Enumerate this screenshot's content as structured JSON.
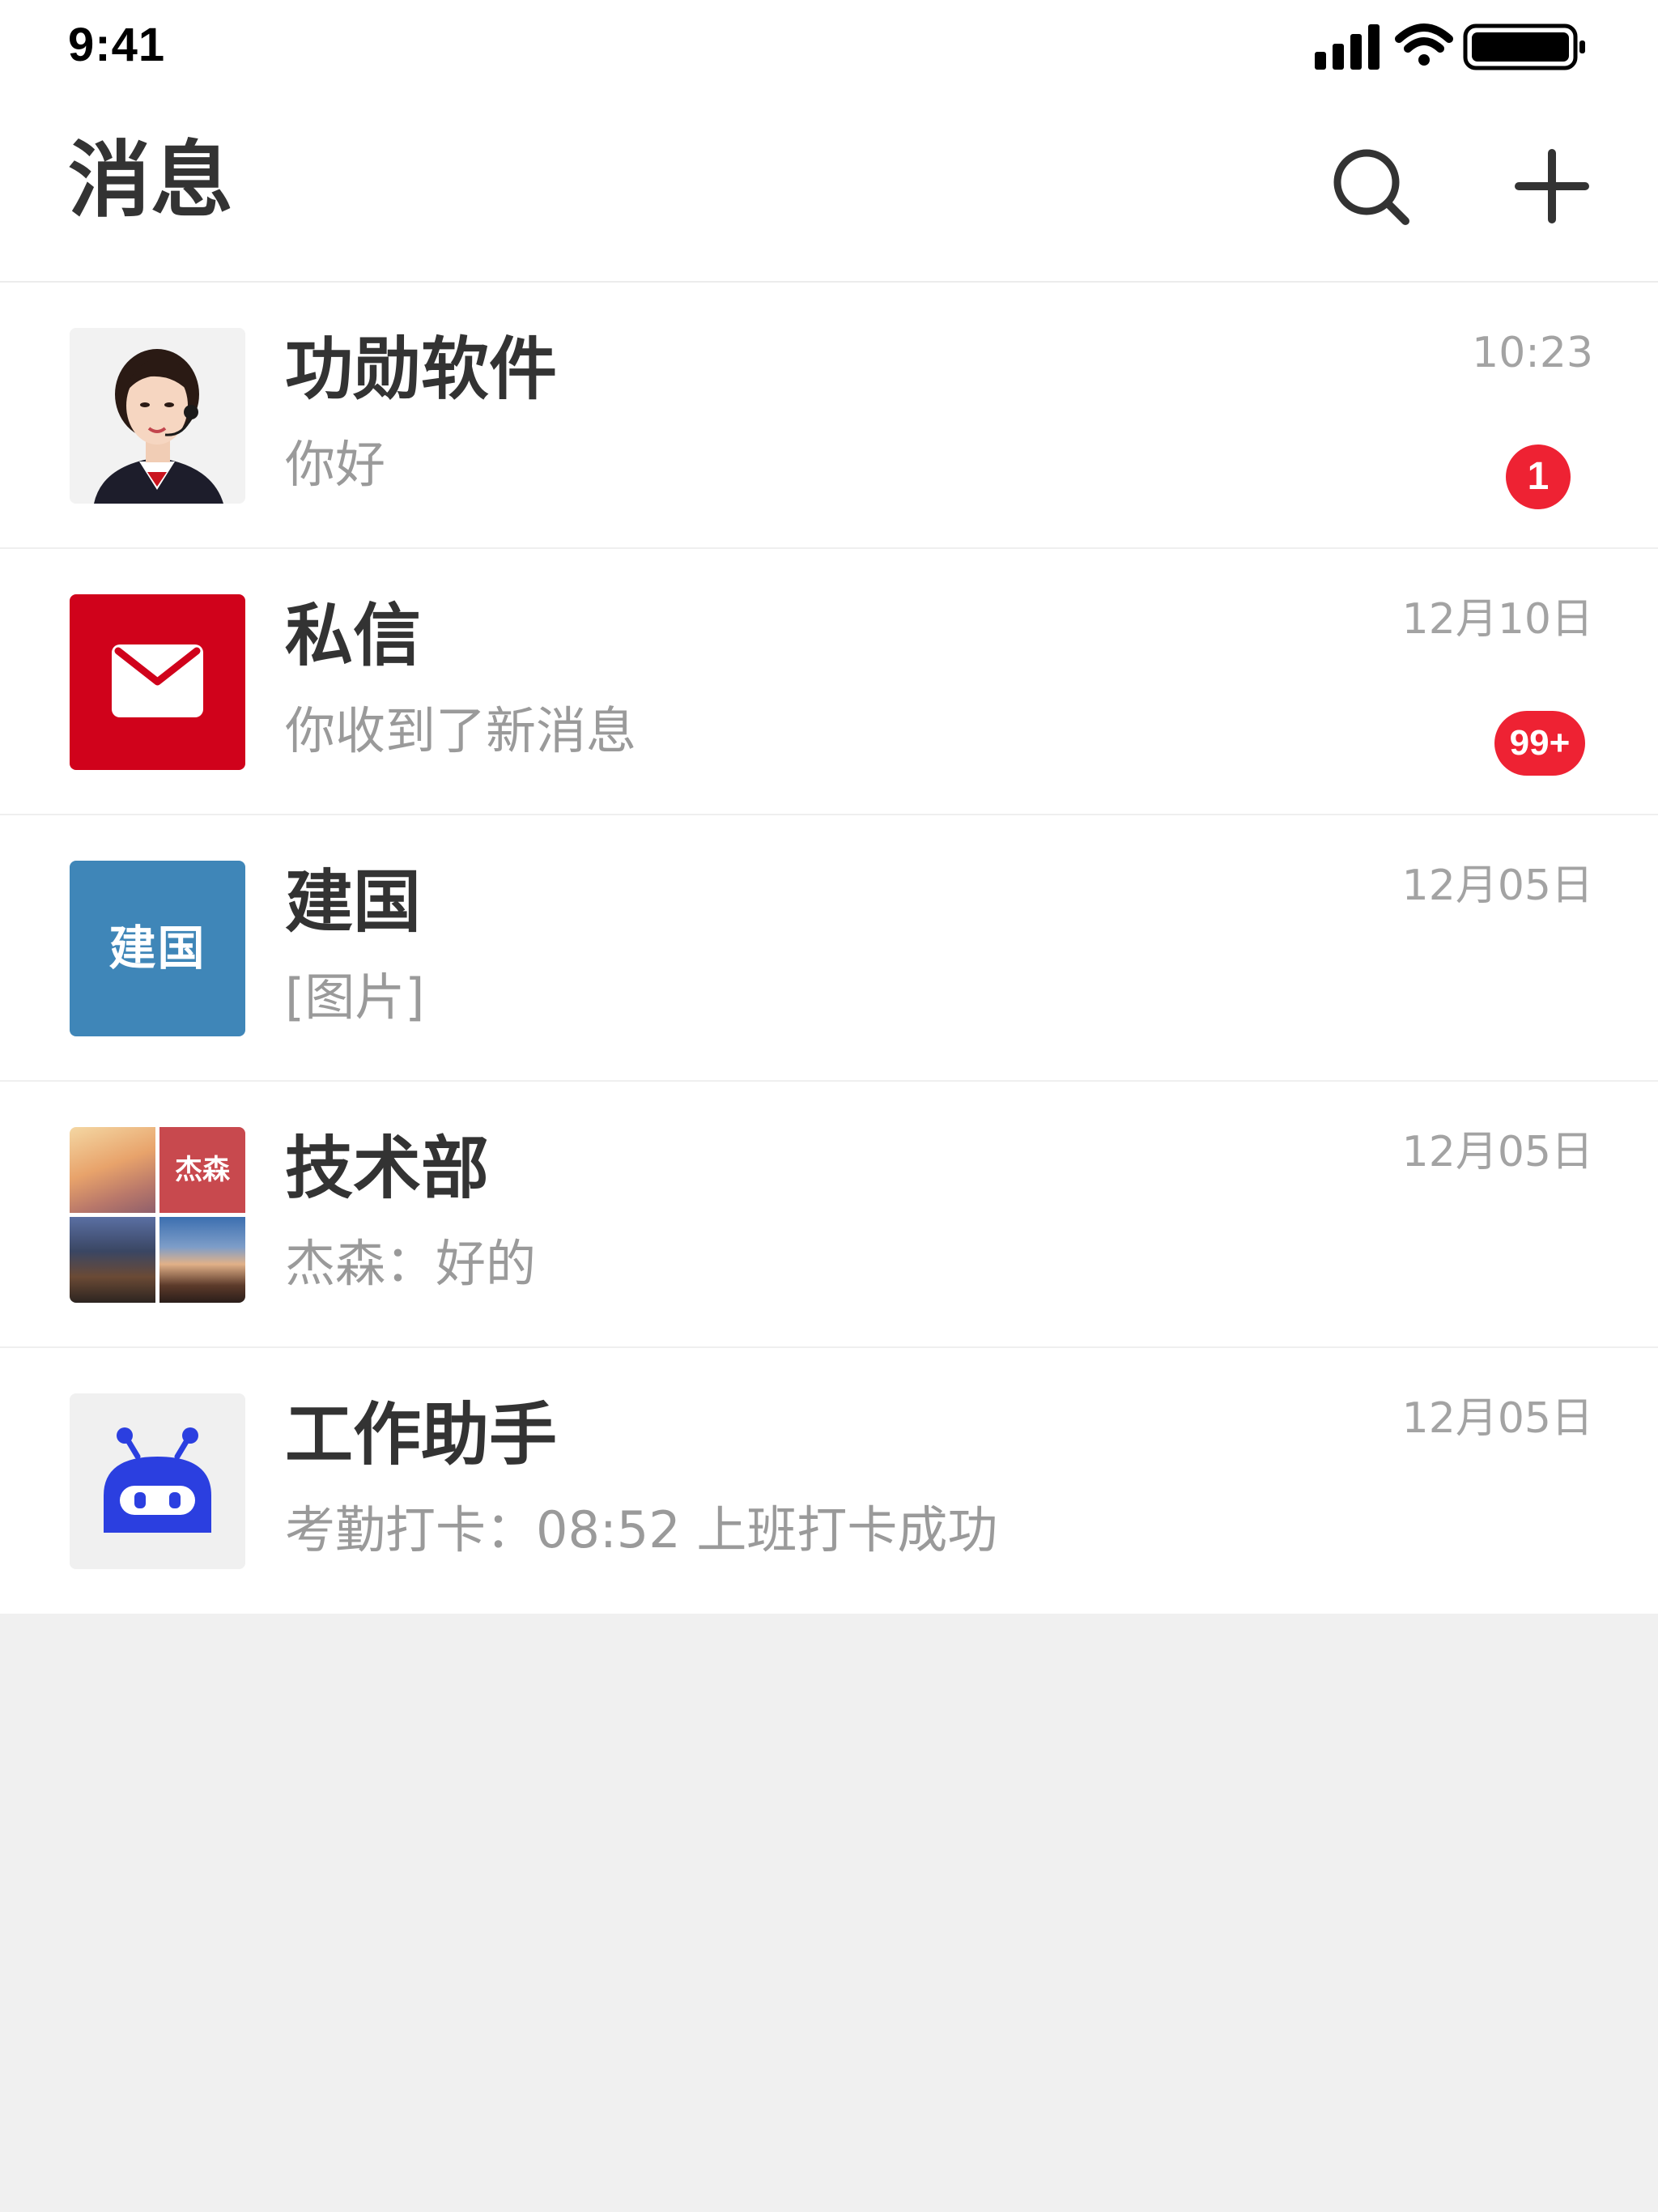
{
  "status_bar": {
    "time": "9:41"
  },
  "header": {
    "title": "消息",
    "search_icon": "search-icon",
    "add_icon": "plus-icon"
  },
  "colors": {
    "badge": "#ee2233",
    "mail_avatar": "#d0021b",
    "text_avatar": "#3f86b8",
    "bot": "#2b3fe0"
  },
  "conversations": [
    {
      "name": "功勋软件",
      "preview": "你好",
      "time": "10:23",
      "badge": "1",
      "avatar": "customer-service-photo"
    },
    {
      "name": "私信",
      "preview": "你收到了新消息",
      "time": "12月10日",
      "badge": "99+",
      "avatar": "mail-icon"
    },
    {
      "name": "建国",
      "preview": "[图片]",
      "time": "12月05日",
      "avatar_text": "建国"
    },
    {
      "name": "技术部",
      "preview": "杰森：好的",
      "time": "12月05日",
      "avatar_tile_text": "杰森",
      "avatar": "group-photo-grid"
    },
    {
      "name": "工作助手",
      "preview": "考勤打卡：08:52 上班打卡成功",
      "time": "12月05日",
      "avatar": "robot-icon"
    }
  ]
}
